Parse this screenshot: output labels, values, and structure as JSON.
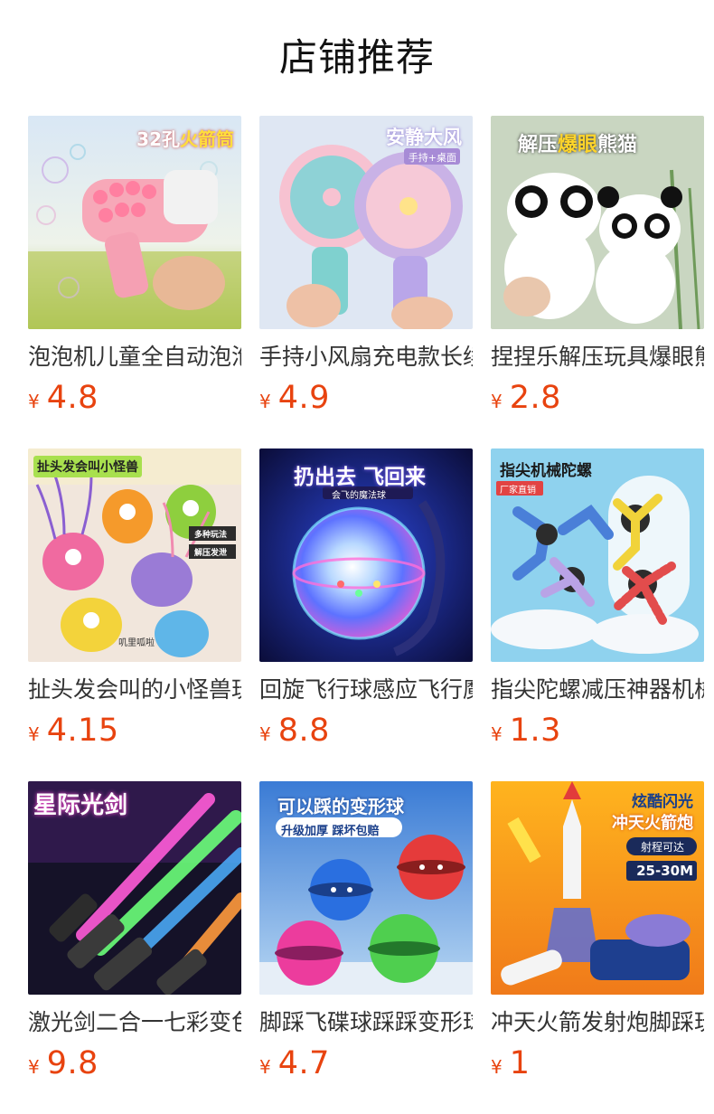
{
  "section": {
    "title": "店铺推荐"
  },
  "currency_symbol": "¥",
  "products": [
    {
      "name": "泡泡机儿童全自动泡泡枪",
      "price": "4.8",
      "image_text": [
        "32孔",
        "火箭筒"
      ],
      "icon": "bubble-gun-icon"
    },
    {
      "name": "手持小风扇充电款长续航",
      "price": "4.9",
      "image_text": [
        "安静大风",
        "手持+桌面"
      ],
      "icon": "handheld-fan-icon"
    },
    {
      "name": "捏捏乐解压玩具爆眼熊猫",
      "price": "2.8",
      "image_text": [
        "解压",
        "爆眼",
        "熊猫"
      ],
      "icon": "panda-squeeze-icon"
    },
    {
      "name": "扯头发会叫的小怪兽玩具",
      "price": "4.15",
      "image_text": [
        "扯头发会叫小怪兽",
        "多种玩法",
        "解压发泄",
        "叽里呱啦"
      ],
      "icon": "hair-monster-icon"
    },
    {
      "name": "回旋飞行球感应飞行魔法球",
      "price": "8.8",
      "image_text": [
        "扔出去 飞回来",
        "会飞的魔法球"
      ],
      "icon": "magic-ball-icon"
    },
    {
      "name": "指尖陀螺减压神器机械陀螺",
      "price": "1.3",
      "image_text": [
        "指尖机械陀螺",
        "厂家直销"
      ],
      "icon": "fidget-spinner-icon"
    },
    {
      "name": "激光剑二合一七彩变色",
      "price": "9.8",
      "image_text": [
        "星际光剑"
      ],
      "icon": "light-saber-icon"
    },
    {
      "name": "脚踩飞碟球踩踩变形球",
      "price": "4.7",
      "image_text": [
        "可以踩的变形球",
        "升级加厚 踩坏包赔"
      ],
      "icon": "flying-saucer-ball-icon"
    },
    {
      "name": "冲天火箭发射炮脚踩玩具",
      "price": "1",
      "image_text": [
        "炫酷闪光",
        "冲天火箭炮",
        "射程可达",
        "25-30M"
      ],
      "icon": "rocket-launcher-icon"
    }
  ]
}
